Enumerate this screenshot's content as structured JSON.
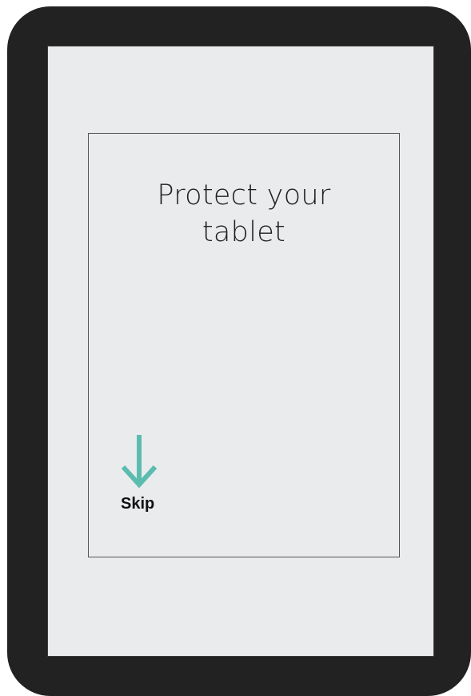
{
  "screen": {
    "title_line1": "Protect your",
    "title_line2": "tablet"
  },
  "skip": {
    "label": "Skip",
    "icon": "arrow-down-icon",
    "accent_color": "#5bbcaf"
  },
  "colors": {
    "frame": "#222222",
    "screen_background": "#eaebed",
    "text": "#1f1f1f"
  }
}
